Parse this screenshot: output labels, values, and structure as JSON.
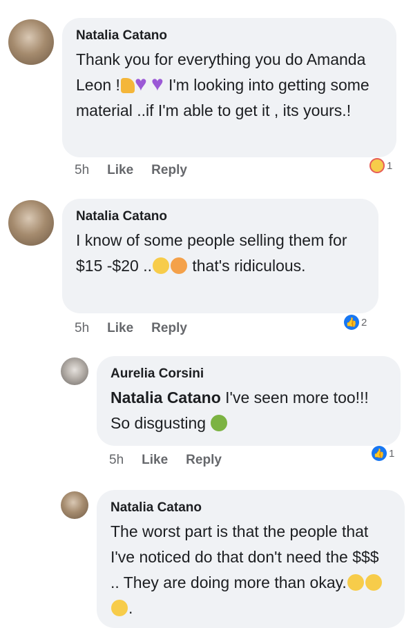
{
  "comments": [
    {
      "author": "Natalia Catano",
      "text_before": "Thank you for everything you do Amanda Leon !",
      "text_after": "I'm looking into getting some material ..if I'm able to get it , its yours.!",
      "time": "5h",
      "like": "Like",
      "reply": "Reply",
      "reaction_count": "1"
    },
    {
      "author": "Natalia Catano",
      "text_before": "I know of some people selling them for $15 -$20 ..",
      "text_after": "that's ridiculous.",
      "time": "5h",
      "like": "Like",
      "reply": "Reply",
      "reaction_count": "2"
    },
    {
      "author": "Aurelia Corsini",
      "mention": "Natalia Catano",
      "text": "I've seen more too!!! So disgusting",
      "time": "5h",
      "like": "Like",
      "reply": "Reply",
      "reaction_count": "1"
    },
    {
      "author": "Natalia Catano",
      "text": "The worst part is that the people that I've noticed do that don't need the $$$ .. They are doing more than okay.",
      "text_end": "."
    }
  ],
  "colors": {
    "bubble": "#f0f2f5",
    "like_blue": "#1877f2",
    "meta": "#65676b"
  }
}
